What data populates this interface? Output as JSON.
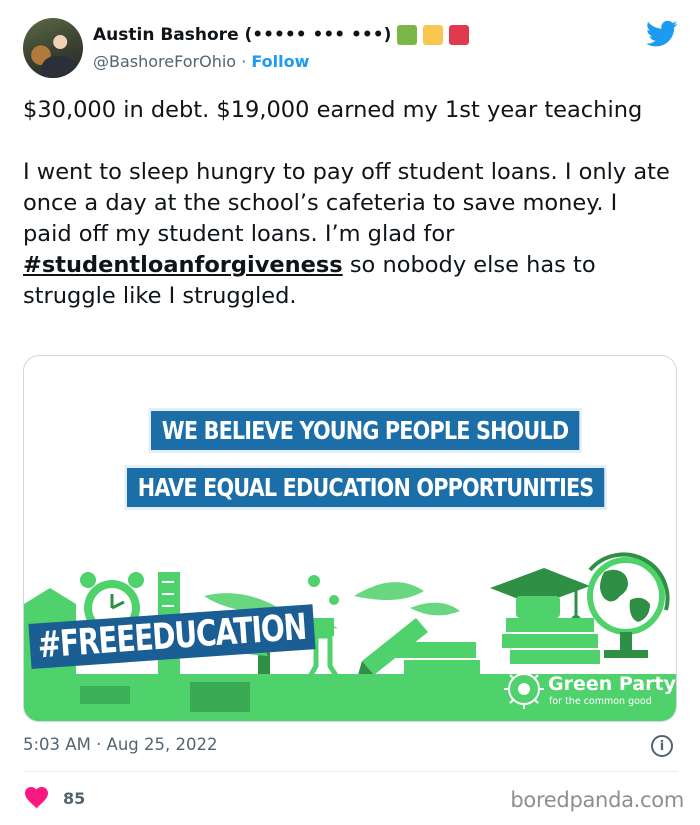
{
  "author": {
    "name": "Austin Bashore (••••• ••• •••)",
    "handle": "@BashoreForOhio",
    "separator": "·",
    "follow_label": "Follow",
    "flag_colors": [
      "#7ab648",
      "#f9c74f",
      "#e03a4e"
    ]
  },
  "tweet": {
    "paragraph1": "$30,000 in debt. $19,000 earned my 1st year teaching",
    "paragraph2_before": "I went to sleep hungry to pay off student loans. I only ate once a day at the school’s cafeteria to save money. I paid off my student loans. I’m glad for ",
    "hashtag": "#studentloanforgiveness",
    "paragraph2_after": " so nobody else has to struggle like I struggled."
  },
  "media": {
    "banner_line1": "WE BELIEVE YOUNG PEOPLE SHOULD",
    "banner_line2": "HAVE EQUAL EDUCATION OPPORTUNITIES",
    "campaign_tag": "#FREEEDUCATION",
    "party_name": "Green Party",
    "party_tagline": "for the common good",
    "accent_green": "#4fd16b",
    "dark_green": "#2e8f45",
    "banner_blue": "#1b6ea8"
  },
  "meta": {
    "timestamp": "5:03 AM · Aug 25, 2022",
    "info_icon": "i"
  },
  "engagement": {
    "likes": "85"
  },
  "watermark": "boredpanda.com",
  "colors": {
    "twitter_blue": "#1d9bf0",
    "heart": "#f91880",
    "text": "#0f1419",
    "muted": "#536471"
  }
}
